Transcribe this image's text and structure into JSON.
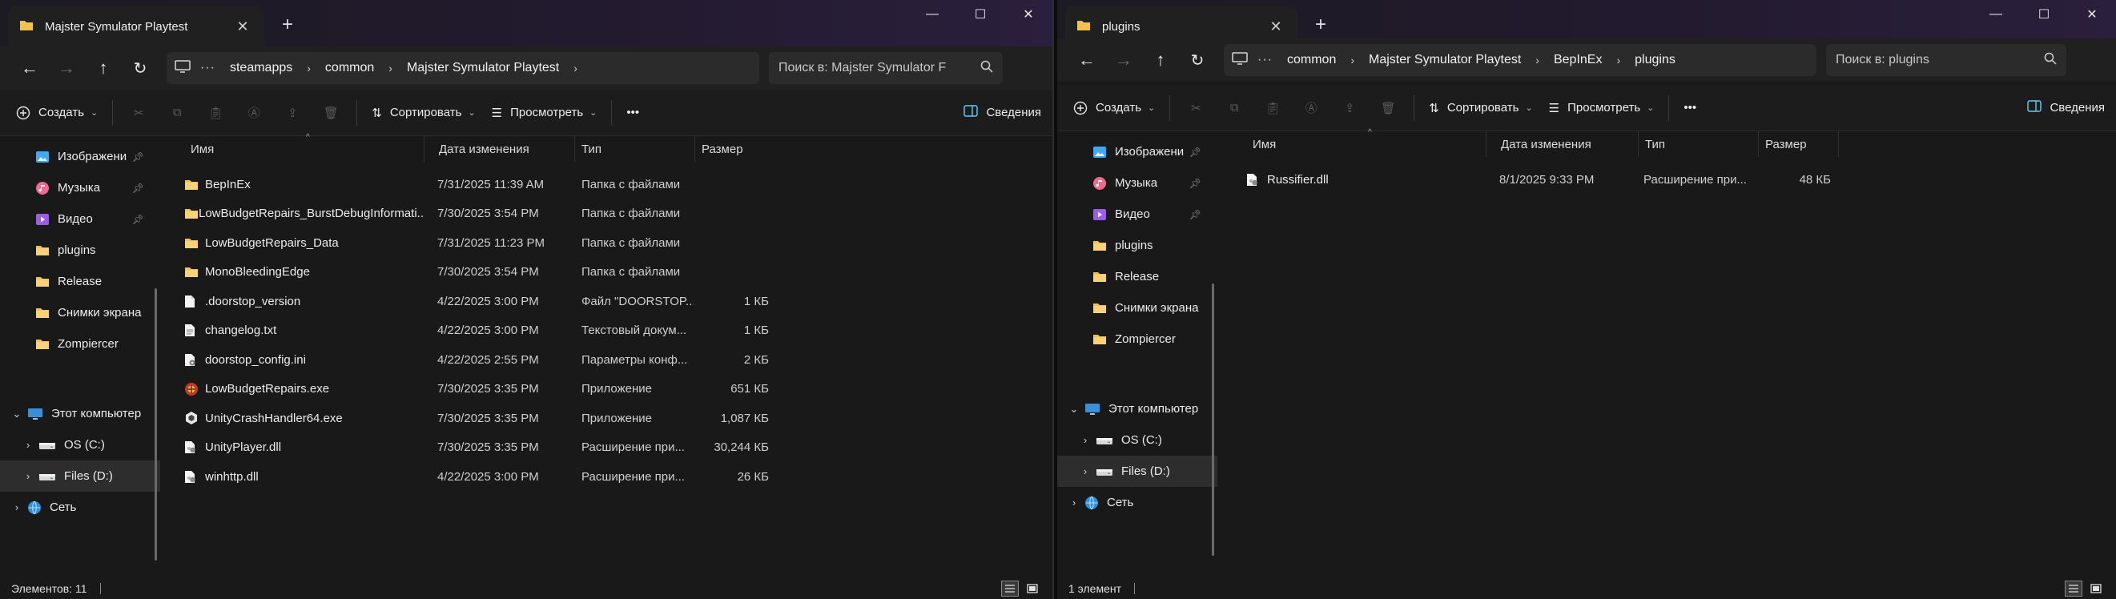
{
  "colors": {
    "folder": "#f2c14e",
    "accent": "#60cdff",
    "bg": "#191919"
  },
  "icons": {
    "back": "arrow-left-icon",
    "forward": "arrow-right-icon",
    "up": "arrow-up-icon",
    "refresh": "refresh-icon",
    "pc": "computer-icon",
    "search": "search-icon",
    "create": "plus-circle-icon",
    "cut": "scissors-icon",
    "copy": "copy-icon",
    "paste": "clipboard-icon",
    "rename": "rename-icon",
    "share": "share-icon",
    "delete": "trash-icon",
    "sort": "sort-icon",
    "view": "view-icon",
    "more": "more-icon",
    "details": "details-pane-icon"
  },
  "toolbar": {
    "create_label": "Создать",
    "sort_label": "Сортировать",
    "view_label": "Просмотреть",
    "more_label": "•••",
    "details_label": "Сведения"
  },
  "columns": {
    "name": "Имя",
    "date": "Дата изменения",
    "type": "Тип",
    "size": "Размер"
  },
  "window1": {
    "tab_title": "Majster Symulator Playtest",
    "breadcrumb": [
      "steamapps",
      "common",
      "Majster Symulator Playtest"
    ],
    "search_placeholder": "Поиск в: Majster Symulator F",
    "sidebar": [
      {
        "label": "Изображени",
        "icon": "images-icon",
        "pinned": true
      },
      {
        "label": "Музыка",
        "icon": "music-icon",
        "pinned": true
      },
      {
        "label": "Видео",
        "icon": "video-icon",
        "pinned": true
      },
      {
        "label": "plugins",
        "icon": "folder-icon",
        "pinned": false
      },
      {
        "label": "Release",
        "icon": "folder-icon",
        "pinned": false
      },
      {
        "label": "Снимки экрана",
        "icon": "folder-icon",
        "pinned": false
      },
      {
        "label": "Zompiercer",
        "icon": "folder-icon",
        "pinned": false
      }
    ],
    "tree": [
      {
        "label": "Этот компьютер",
        "icon": "computer-icon",
        "expander": "⌄",
        "level": 0
      },
      {
        "label": "OS (C:)",
        "icon": "drive-icon",
        "expander": "›",
        "level": 1
      },
      {
        "label": "Files (D:)",
        "icon": "drive-icon",
        "expander": "›",
        "level": 1,
        "selected": true
      },
      {
        "label": "Сеть",
        "icon": "network-icon",
        "expander": "›",
        "level": 0
      }
    ],
    "files": [
      {
        "name": "BepInEx",
        "date": "7/31/2025 11:39 AM",
        "type": "Папка с файлами",
        "size": "",
        "icon": "folder-icon"
      },
      {
        "name": "LowBudgetRepairs_BurstDebugInformati...",
        "date": "7/30/2025 3:54 PM",
        "type": "Папка с файлами",
        "size": "",
        "icon": "folder-icon"
      },
      {
        "name": "LowBudgetRepairs_Data",
        "date": "7/31/2025 11:23 PM",
        "type": "Папка с файлами",
        "size": "",
        "icon": "folder-icon"
      },
      {
        "name": "MonoBleedingEdge",
        "date": "7/30/2025 3:54 PM",
        "type": "Папка с файлами",
        "size": "",
        "icon": "folder-icon"
      },
      {
        "name": ".doorstop_version",
        "date": "4/22/2025 3:00 PM",
        "type": "Файл \"DOORSTOP...",
        "size": "1 КБ",
        "icon": "file-icon"
      },
      {
        "name": "changelog.txt",
        "date": "4/22/2025 3:00 PM",
        "type": "Текстовый докум...",
        "size": "1 КБ",
        "icon": "text-file-icon"
      },
      {
        "name": "doorstop_config.ini",
        "date": "4/22/2025 2:55 PM",
        "type": "Параметры конф...",
        "size": "2 КБ",
        "icon": "config-file-icon"
      },
      {
        "name": "LowBudgetRepairs.exe",
        "date": "7/30/2025 3:35 PM",
        "type": "Приложение",
        "size": "651 КБ",
        "icon": "app-exe-icon"
      },
      {
        "name": "UnityCrashHandler64.exe",
        "date": "7/30/2025 3:35 PM",
        "type": "Приложение",
        "size": "1,087 КБ",
        "icon": "unity-exe-icon"
      },
      {
        "name": "UnityPlayer.dll",
        "date": "7/30/2025 3:35 PM",
        "type": "Расширение при...",
        "size": "30,244 КБ",
        "icon": "dll-file-icon"
      },
      {
        "name": "winhttp.dll",
        "date": "4/22/2025 3:00 PM",
        "type": "Расширение при...",
        "size": "26 КБ",
        "icon": "dll-file-icon"
      }
    ],
    "status": "Элементов: 11"
  },
  "window2": {
    "tab_title": "plugins",
    "breadcrumb": [
      "common",
      "Majster Symulator Playtest",
      "BepInEx",
      "plugins"
    ],
    "search_placeholder": "Поиск в: plugins",
    "sidebar": [
      {
        "label": "Изображени",
        "icon": "images-icon",
        "pinned": true
      },
      {
        "label": "Музыка",
        "icon": "music-icon",
        "pinned": true
      },
      {
        "label": "Видео",
        "icon": "video-icon",
        "pinned": true
      },
      {
        "label": "plugins",
        "icon": "folder-icon",
        "pinned": false
      },
      {
        "label": "Release",
        "icon": "folder-icon",
        "pinned": false
      },
      {
        "label": "Снимки экрана",
        "icon": "folder-icon",
        "pinned": false
      },
      {
        "label": "Zompiercer",
        "icon": "folder-icon",
        "pinned": false
      }
    ],
    "tree": [
      {
        "label": "Этот компьютер",
        "icon": "computer-icon",
        "expander": "⌄",
        "level": 0
      },
      {
        "label": "OS (C:)",
        "icon": "drive-icon",
        "expander": "›",
        "level": 1
      },
      {
        "label": "Files (D:)",
        "icon": "drive-icon",
        "expander": "›",
        "level": 1,
        "selected": true
      },
      {
        "label": "Сеть",
        "icon": "network-icon",
        "expander": "›",
        "level": 0
      }
    ],
    "files": [
      {
        "name": "Russifier.dll",
        "date": "8/1/2025 9:33 PM",
        "type": "Расширение при...",
        "size": "48 КБ",
        "icon": "dll-file-icon"
      }
    ],
    "status": "1 элемент"
  }
}
